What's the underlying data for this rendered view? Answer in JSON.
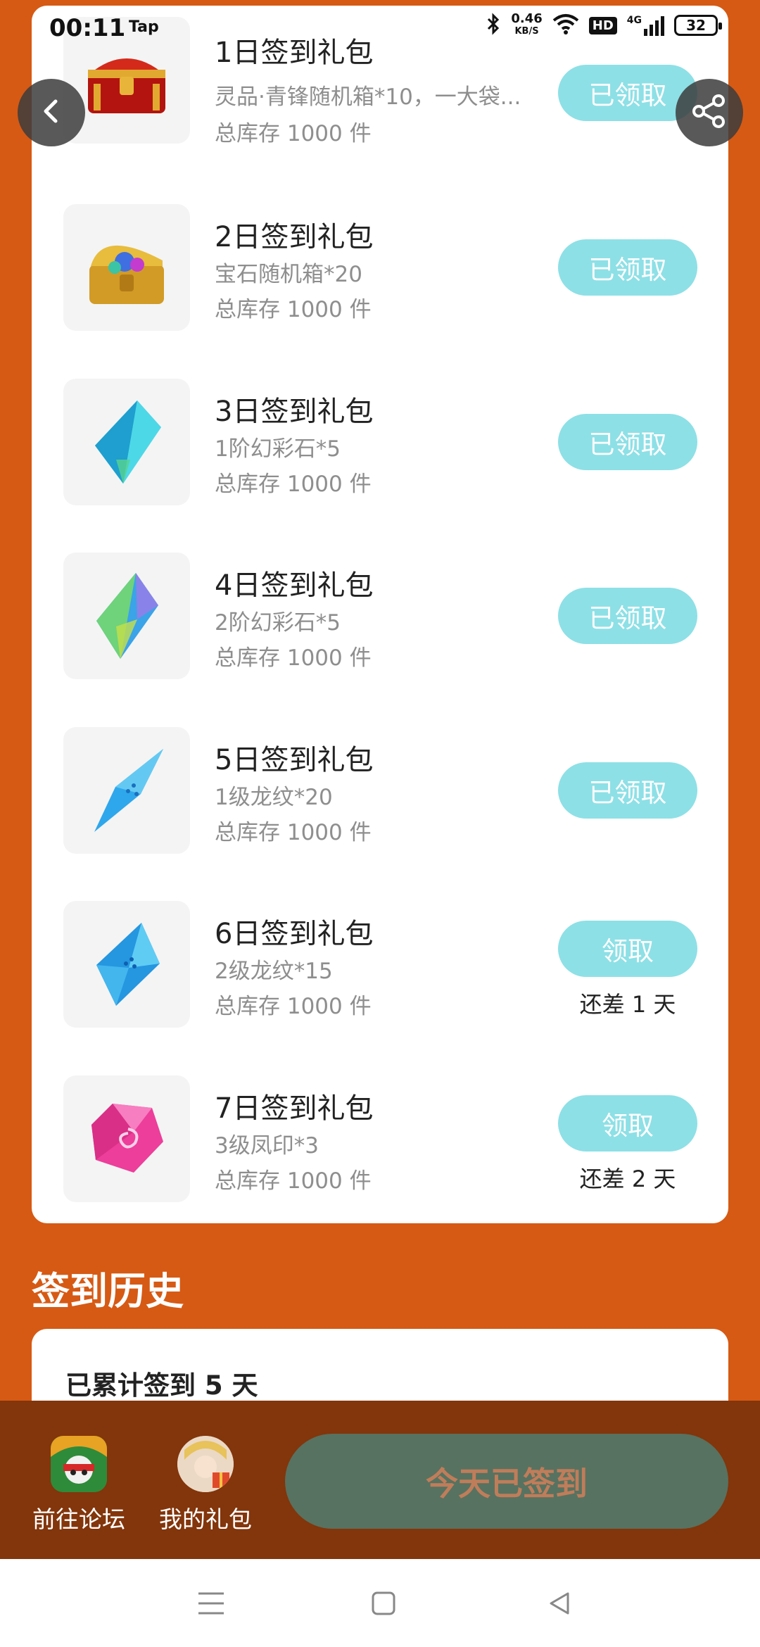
{
  "status_bar": {
    "time": "00:11",
    "app": "Tap",
    "net_speed_value": "0.46",
    "net_speed_unit": "KB/S",
    "hd": "HD",
    "network": "4G",
    "battery": "32"
  },
  "gifts": [
    {
      "title": "1日签到礼包",
      "desc": "灵品·青锋随机箱*10，一大袋...",
      "stock": "总库存 1000 件",
      "button": "已领取",
      "status": "claimed",
      "days_left": "",
      "icon": "red-treasure-chest-icon"
    },
    {
      "title": "2日签到礼包",
      "desc": "宝石随机箱*20",
      "stock": "总库存 1000 件",
      "button": "已领取",
      "status": "claimed",
      "days_left": "",
      "icon": "gold-treasure-chest-icon"
    },
    {
      "title": "3日签到礼包",
      "desc": "1阶幻彩石*5",
      "stock": "总库存 1000 件",
      "button": "已领取",
      "status": "claimed",
      "days_left": "",
      "icon": "cyan-crystal-icon"
    },
    {
      "title": "4日签到礼包",
      "desc": "2阶幻彩石*5",
      "stock": "总库存 1000 件",
      "button": "已领取",
      "status": "claimed",
      "days_left": "",
      "icon": "rainbow-crystal-icon"
    },
    {
      "title": "5日签到礼包",
      "desc": "1级龙纹*20",
      "stock": "总库存 1000 件",
      "button": "已领取",
      "status": "claimed",
      "days_left": "",
      "icon": "blue-shard-icon"
    },
    {
      "title": "6日签到礼包",
      "desc": "2级龙纹*15",
      "stock": "总库存 1000 件",
      "button": "领取",
      "status": "pending",
      "days_left": "还差 1 天",
      "icon": "blue-gem-icon"
    },
    {
      "title": "7日签到礼包",
      "desc": "3级凤印*3",
      "stock": "总库存 1000 件",
      "button": "领取",
      "status": "pending",
      "days_left": "还差 2 天",
      "icon": "pink-gem-icon"
    }
  ],
  "history": {
    "title": "签到历史",
    "summary": "已累计签到 5 天"
  },
  "bottom_bar": {
    "forum_label": "前往论坛",
    "gifts_label": "我的礼包",
    "signed_button": "今天已签到"
  },
  "colors": {
    "background": "#D65A14",
    "claim_button": "#8DE0E6",
    "bottom_bar": "#83350B",
    "signed_button": "#577260"
  }
}
